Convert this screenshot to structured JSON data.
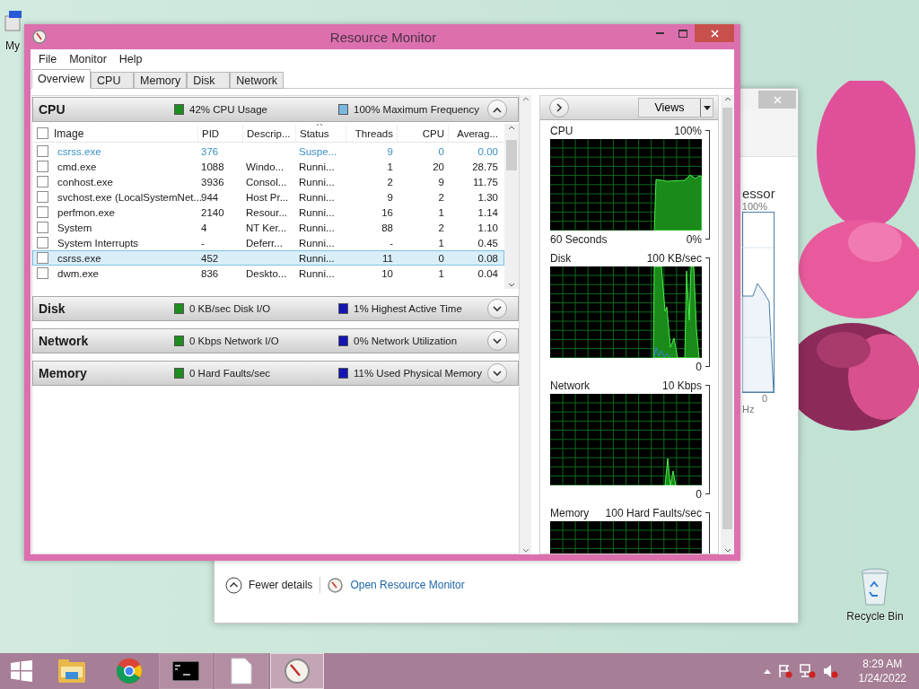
{
  "desktop": {
    "icons": [
      {
        "kind": "computer",
        "label": "My"
      },
      {
        "kind": "recycle",
        "label": "Recycle Bin"
      }
    ]
  },
  "back_window": {
    "heading": "essor",
    "chart_max": "100%",
    "chart_min": "0",
    "axis_label": "Hz",
    "footer": {
      "toggle": "Fewer details",
      "link": "Open Resource Monitor"
    }
  },
  "window": {
    "title": "Resource Monitor"
  },
  "menu": [
    "File",
    "Monitor",
    "Help"
  ],
  "tabs": [
    {
      "label": "Overview",
      "selected": true
    },
    {
      "label": "CPU",
      "selected": false
    },
    {
      "label": "Memory",
      "selected": false
    },
    {
      "label": "Disk",
      "selected": false
    },
    {
      "label": "Network",
      "selected": false
    }
  ],
  "sections": [
    {
      "title": "CPU",
      "expanded": true,
      "stats": [
        {
          "label": "42% CPU Usage",
          "color": "#1e8c1e"
        },
        {
          "label": "100% Maximum Frequency",
          "color": "#7ab8e0"
        }
      ],
      "table": {
        "header_checked": false,
        "columns": [
          {
            "label": "Image",
            "sorted": false
          },
          {
            "label": "PID",
            "sorted": false
          },
          {
            "label": "Descrip...",
            "sorted": false
          },
          {
            "label": "Status",
            "sorted": true
          },
          {
            "label": "Threads",
            "sorted": false
          },
          {
            "label": "CPU",
            "sorted": false
          },
          {
            "label": "Averag...",
            "sorted": false
          }
        ],
        "rows": [
          {
            "checked": false,
            "selected": false,
            "suspended": true,
            "cells": [
              "csrss.exe",
              "376",
              "",
              "Suspe...",
              "9",
              "0",
              "0.00"
            ]
          },
          {
            "checked": false,
            "selected": false,
            "suspended": false,
            "cells": [
              "cmd.exe",
              "1088",
              "Windo...",
              "Runni...",
              "1",
              "20",
              "28.75"
            ]
          },
          {
            "checked": false,
            "selected": false,
            "suspended": false,
            "cells": [
              "conhost.exe",
              "3936",
              "Consol...",
              "Runni...",
              "2",
              "9",
              "11.75"
            ]
          },
          {
            "checked": false,
            "selected": false,
            "suspended": false,
            "cells": [
              "svchost.exe (LocalSystemNet...",
              "944",
              "Host Pr...",
              "Runni...",
              "9",
              "2",
              "1.30"
            ]
          },
          {
            "checked": false,
            "selected": false,
            "suspended": false,
            "cells": [
              "perfmon.exe",
              "2140",
              "Resour...",
              "Runni...",
              "16",
              "1",
              "1.14"
            ]
          },
          {
            "checked": false,
            "selected": false,
            "suspended": false,
            "cells": [
              "System",
              "4",
              "NT Ker...",
              "Runni...",
              "88",
              "2",
              "1.10"
            ]
          },
          {
            "checked": false,
            "selected": false,
            "suspended": false,
            "cells": [
              "System Interrupts",
              "-",
              "Deferr...",
              "Runni...",
              "-",
              "1",
              "0.45"
            ]
          },
          {
            "checked": false,
            "selected": true,
            "suspended": false,
            "cells": [
              "csrss.exe",
              "452",
              "",
              "Runni...",
              "11",
              "0",
              "0.08"
            ]
          },
          {
            "checked": false,
            "selected": false,
            "suspended": false,
            "cells": [
              "dwm.exe",
              "836",
              "Deskto...",
              "Runni...",
              "10",
              "1",
              "0.04"
            ]
          }
        ]
      }
    },
    {
      "title": "Disk",
      "expanded": false,
      "stats": [
        {
          "label": "0 KB/sec Disk I/O",
          "color": "#1e8c1e"
        },
        {
          "label": "1% Highest Active Time",
          "color": "#1414b4"
        }
      ]
    },
    {
      "title": "Network",
      "expanded": false,
      "stats": [
        {
          "label": "0 Kbps Network I/O",
          "color": "#1e8c1e"
        },
        {
          "label": "0% Network Utilization",
          "color": "#1414b4"
        }
      ]
    },
    {
      "title": "Memory",
      "expanded": false,
      "stats": [
        {
          "label": "0 Hard Faults/sec",
          "color": "#1e8c1e"
        },
        {
          "label": "11% Used Physical Memory",
          "color": "#1414b4"
        }
      ]
    }
  ],
  "graph_panel": {
    "views": "Views",
    "graphs": [
      {
        "kind": "plateau",
        "title": "CPU",
        "max": "100%",
        "span": "60 Seconds",
        "min": "0%"
      },
      {
        "kind": "spikes",
        "title": "Disk",
        "max": "100 KB/sec",
        "min": "0"
      },
      {
        "kind": "blip",
        "title": "Network",
        "max": "10 Kbps",
        "min": "0"
      },
      {
        "kind": "flat",
        "title": "Memory",
        "max": "100 Hard Faults/sec"
      }
    ]
  },
  "taskbar": {
    "apps": [
      {
        "kind": "files",
        "running": false,
        "active": false
      },
      {
        "kind": "browser",
        "running": false,
        "active": false
      },
      {
        "kind": "console",
        "running": true,
        "active": false
      },
      {
        "kind": "document",
        "running": true,
        "active": false
      },
      {
        "kind": "monitor",
        "running": true,
        "active": true
      }
    ],
    "clock": {
      "time": "8:29 AM",
      "date": "1/24/2022"
    }
  }
}
